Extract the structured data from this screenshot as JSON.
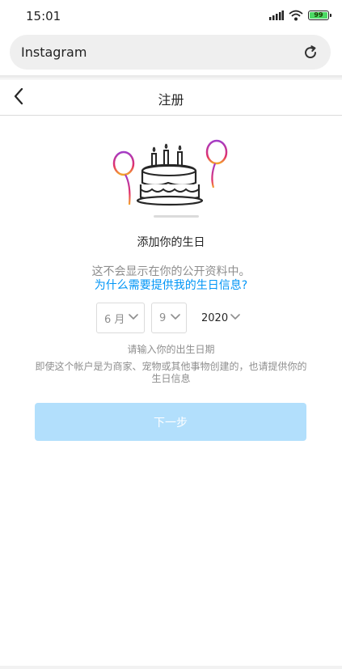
{
  "status_bar": {
    "time": "15:01",
    "battery_level": "99",
    "icons": [
      "signal-icon",
      "wifi-icon",
      "battery-icon"
    ],
    "battery_color": "#4cd964"
  },
  "browser": {
    "url_text": "Instagram",
    "reload_icon": "reload-icon"
  },
  "header": {
    "title": "注册",
    "back_icon": "chevron-left-icon"
  },
  "illustration": {
    "icon": "birthday-cake-icon",
    "balloon_colors": [
      "#a33cc7",
      "#f4a52b",
      "#e1306c"
    ]
  },
  "main": {
    "title": "添加你的生日",
    "info": "这不会显示在你的公开资料中。",
    "why_link": "为什么需要提供我的生日信息?",
    "month_value": "6 月",
    "day_value": "9",
    "year_value": "2020",
    "hint_enter": "请输入你的出生日期",
    "hint_business": "即使这个帐户是为商家、宠物或其他事物创建的，也请提供你的生日信息",
    "next_label": "下一步",
    "next_button_color": "#b2dffc",
    "link_color": "#0095f6"
  }
}
